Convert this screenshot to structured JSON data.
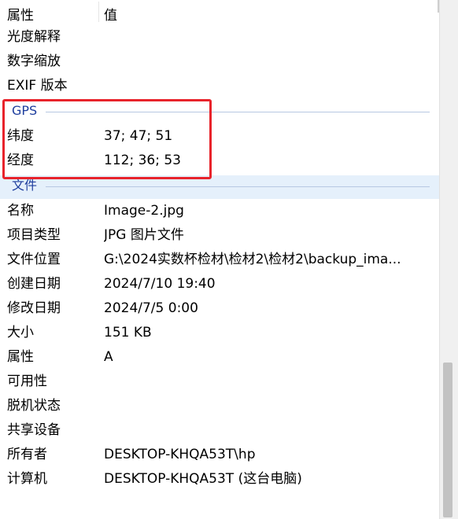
{
  "header": {
    "name_col": "属性",
    "value_col": "值"
  },
  "top_rows": [
    {
      "name": "光度解释",
      "value": ""
    },
    {
      "name": "数字缩放",
      "value": ""
    },
    {
      "name": "EXIF 版本",
      "value": ""
    }
  ],
  "gps_group": {
    "label": "GPS",
    "rows": [
      {
        "name": "纬度",
        "value": "37; 47; 51"
      },
      {
        "name": "经度",
        "value": "112; 36; 53"
      }
    ]
  },
  "file_group": {
    "label": "文件",
    "rows": [
      {
        "name": "名称",
        "value": "Image-2.jpg"
      },
      {
        "name": "项目类型",
        "value": "JPG 图片文件"
      },
      {
        "name": "文件位置",
        "value": "G:\\2024实数杯检材\\检材2\\检材2\\backup_ima..."
      },
      {
        "name": "创建日期",
        "value": "2024/7/10 19:40"
      },
      {
        "name": "修改日期",
        "value": "2024/7/5 0:00"
      },
      {
        "name": "大小",
        "value": "151 KB"
      },
      {
        "name": "属性",
        "value": "A"
      },
      {
        "name": "可用性",
        "value": ""
      },
      {
        "name": "脱机状态",
        "value": ""
      },
      {
        "name": "共享设备",
        "value": ""
      },
      {
        "name": "所有者",
        "value": "DESKTOP-KHQA53T\\hp"
      },
      {
        "name": "计算机",
        "value": "DESKTOP-KHQA53T (这台电脑)"
      }
    ]
  },
  "colors": {
    "highlight_box": "#e8232b",
    "group_label": "#1e3e9e",
    "selected_group_bg": "#e5f0fb"
  }
}
